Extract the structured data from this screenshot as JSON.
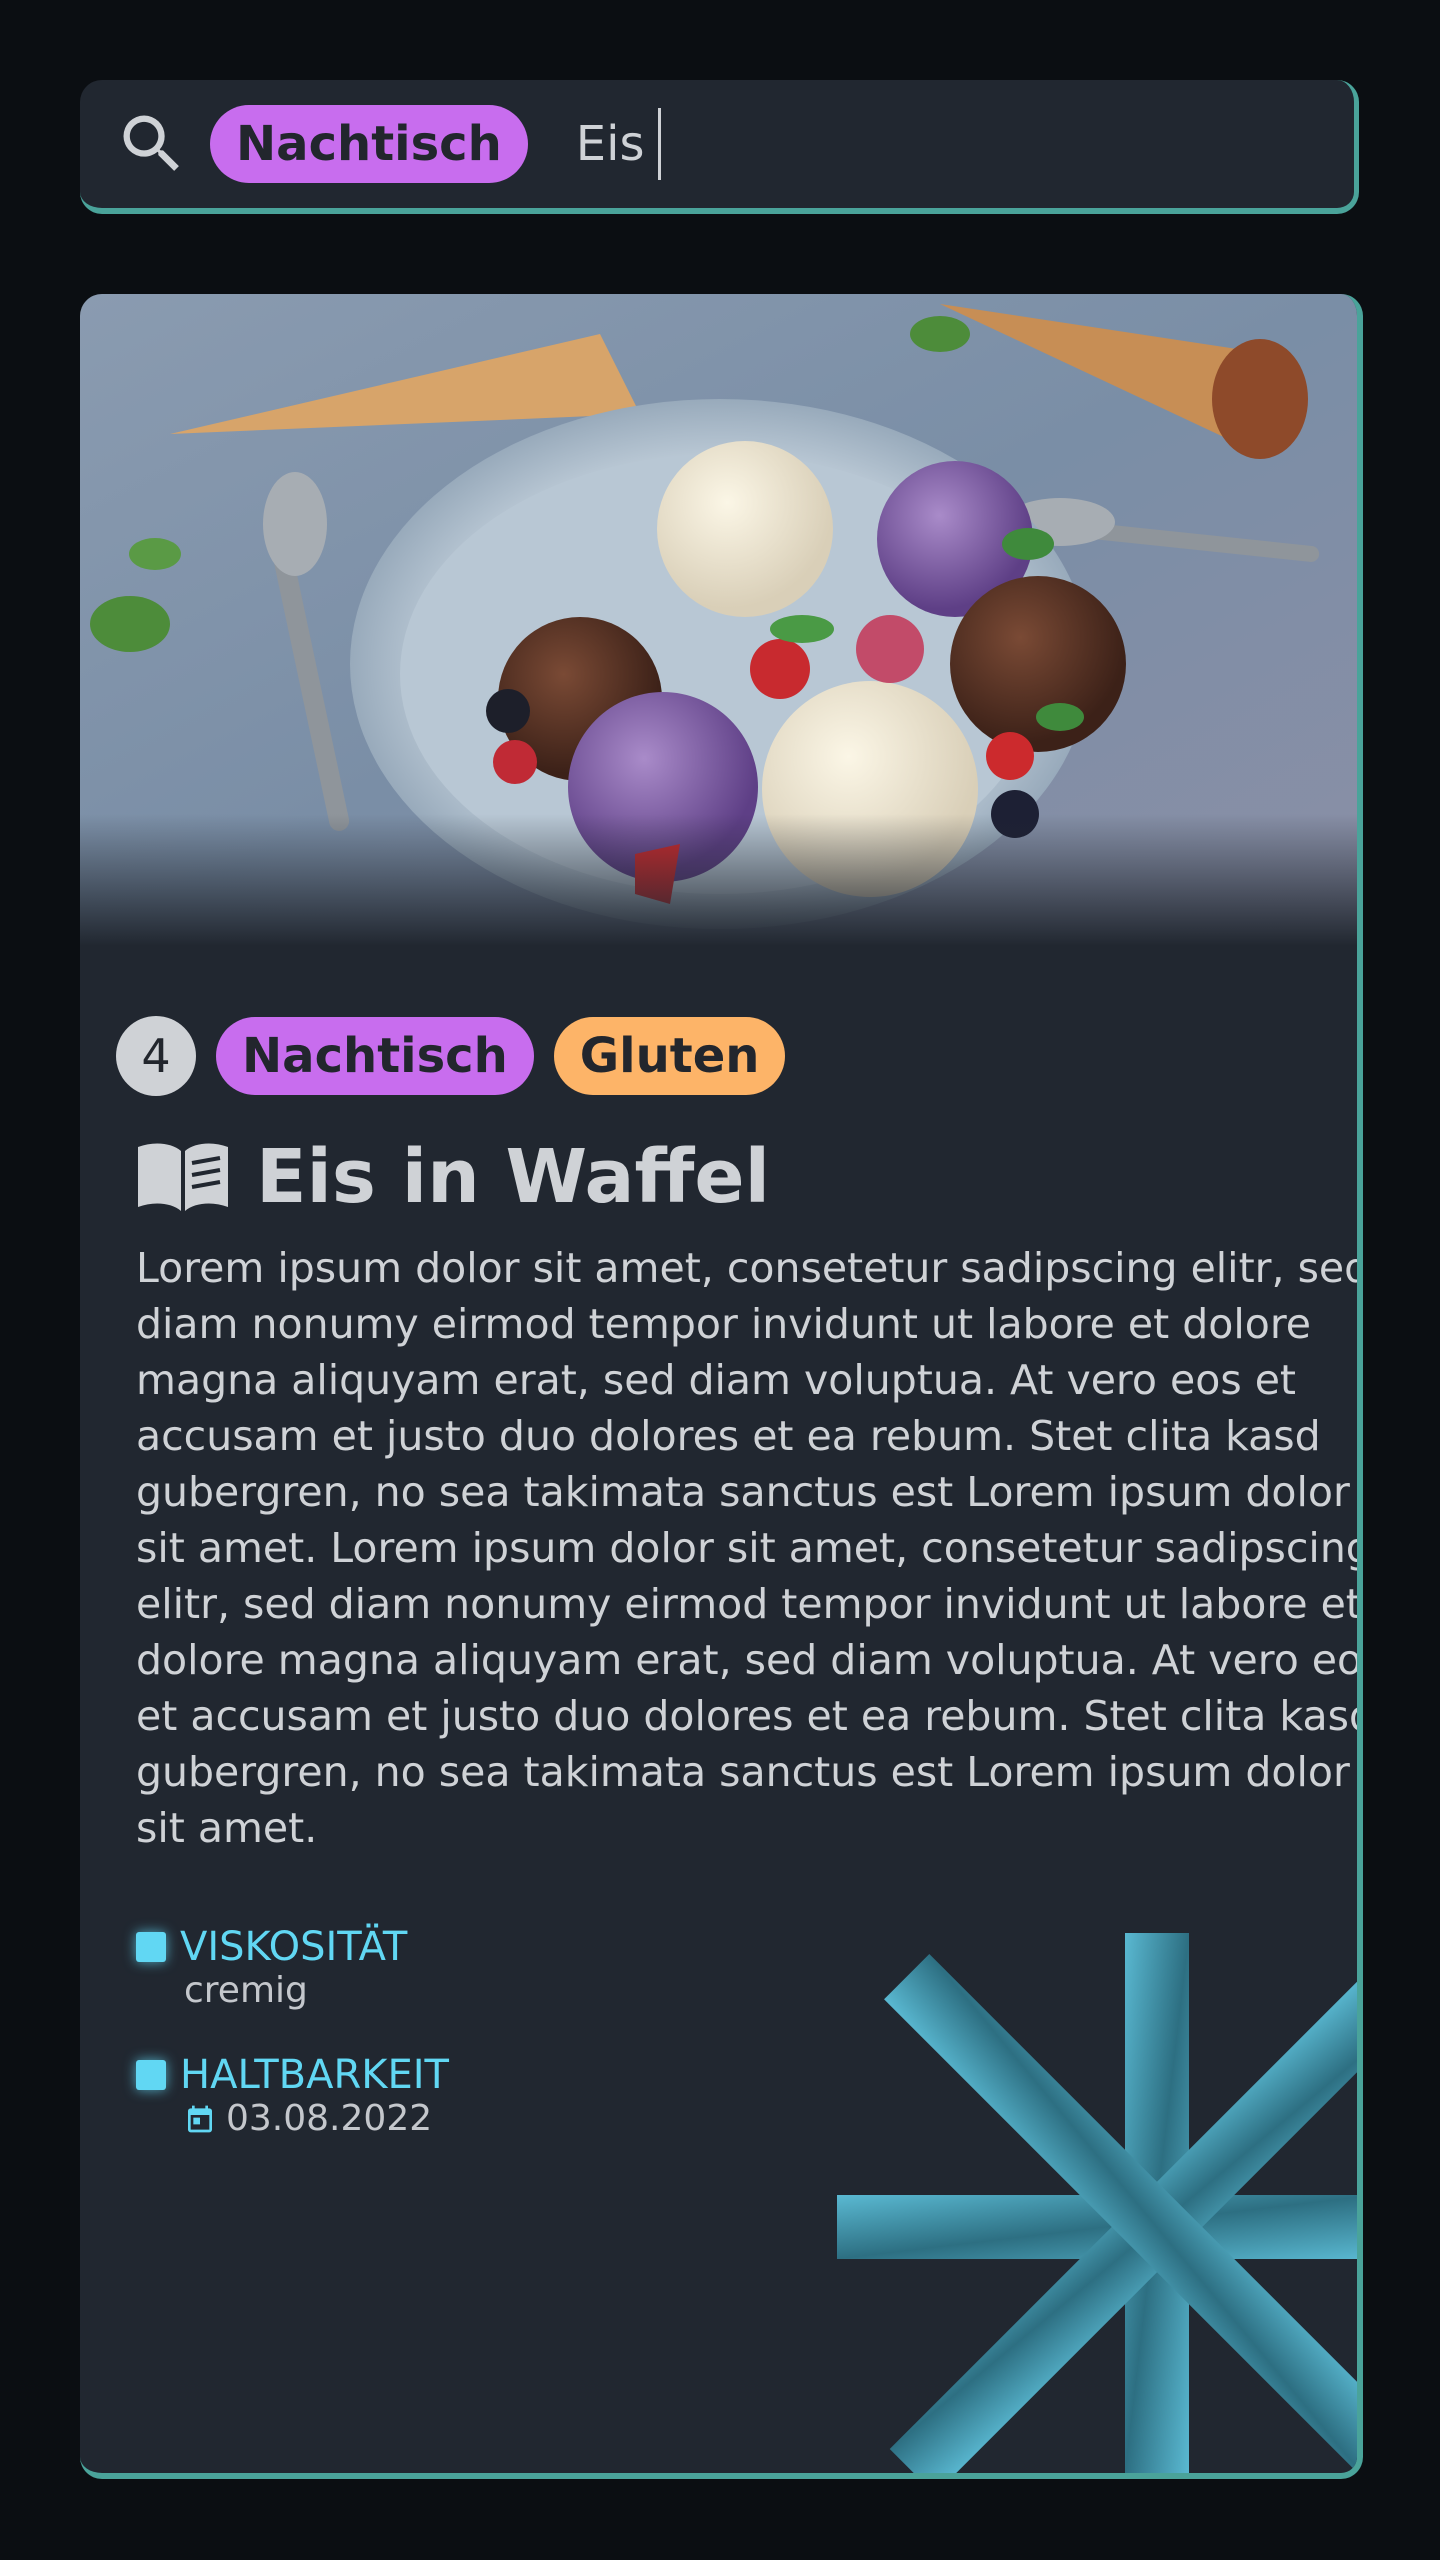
{
  "search": {
    "filter_tag": "Nachtisch",
    "query": "Eis"
  },
  "recipe": {
    "count": "4",
    "tags": [
      "Nachtisch",
      "Gluten"
    ],
    "title": "Eis in Waffel",
    "description": "Lorem ipsum dolor sit amet, consetetur sadipscing elitr, sed diam nonumy eirmod tempor invidunt ut labore et dolore magna aliquyam erat, sed diam voluptua. At vero eos et accusam et justo duo dolores et ea rebum. Stet clita kasd gubergren, no sea takimata sanctus est Lorem ipsum dolor sit amet. Lorem ipsum dolor sit amet, consetetur sadipscing elitr, sed diam nonumy eirmod tempor invidunt ut labore et dolore magna aliquyam erat, sed diam voluptua. At vero eos et accusam et justo duo dolores et ea rebum. Stet clita kasd gubergren, no sea takimata sanctus est Lorem ipsum dolor sit amet.",
    "properties": [
      {
        "label": "VISKOSITÄT",
        "value": "cremig"
      },
      {
        "label": "HALTBARKEIT",
        "value": "03.08.2022"
      }
    ]
  },
  "icons": {
    "search": "search-icon",
    "book": "book-icon",
    "calendar": "calendar-icon",
    "storage": "snowflake-icon"
  },
  "colors": {
    "background": "#0b0e12",
    "surface": "#212730",
    "border_accent": "#4aa39a",
    "tag_dessert": "#c86dee",
    "tag_gluten": "#fdb468",
    "property_accent": "#61d7f3",
    "text": "#cfd2d6"
  }
}
